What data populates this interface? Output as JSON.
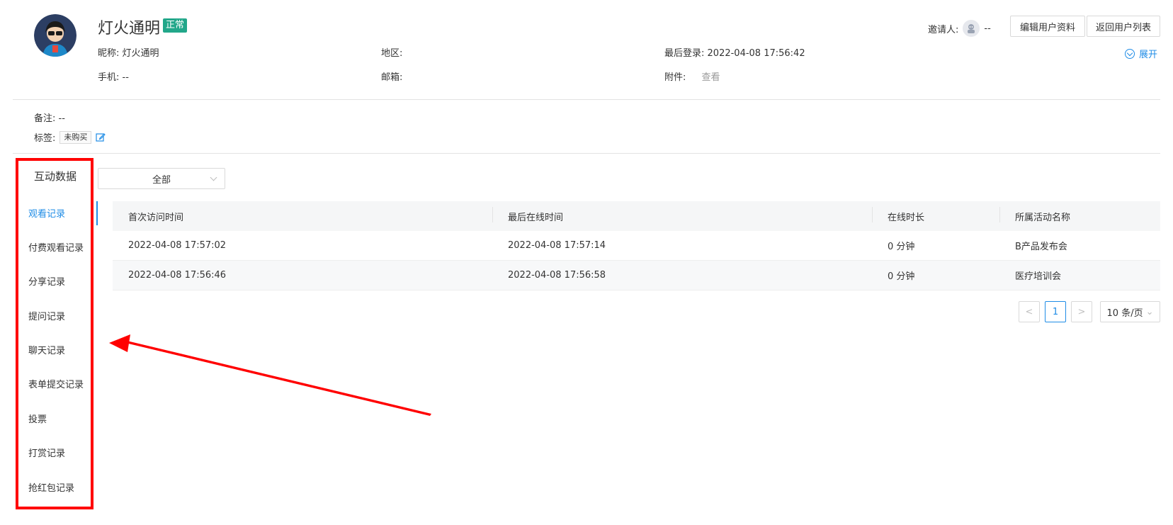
{
  "user": {
    "name": "灯火通明",
    "status": "正常",
    "nickname_label": "昵称:",
    "nickname": "灯火通明",
    "region_label": "地区:",
    "region": "",
    "last_login_label": "最后登录:",
    "last_login": "2022-04-08 17:56:42",
    "phone_label": "手机:",
    "phone": "--",
    "email_label": "邮箱:",
    "email": "",
    "attachment_label": "附件:",
    "attachment_link": "查看",
    "remark_label": "备注:",
    "remark": "--",
    "tags_label": "标签:",
    "tags": [
      "未购买"
    ]
  },
  "header": {
    "inviter_label": "邀请人:",
    "inviter_value": "--",
    "edit_button": "编辑用户资料",
    "back_button": "返回用户列表",
    "expand_label": "展开"
  },
  "sidebar": {
    "title": "互动数据",
    "active_index": 0,
    "items": [
      "观看记录",
      "付费观看记录",
      "分享记录",
      "提问记录",
      "聊天记录",
      "表单提交记录",
      "投票",
      "打赏记录",
      "抢红包记录"
    ]
  },
  "filter": {
    "selected": "全部"
  },
  "table": {
    "columns": [
      "首次访问时间",
      "最后在线时间",
      "在线时长",
      "所属活动名称"
    ],
    "rows": [
      [
        "2022-04-08 17:57:02",
        "2022-04-08 17:57:14",
        "0 分钟",
        "B产品发布会"
      ],
      [
        "2022-04-08 17:56:46",
        "2022-04-08 17:56:58",
        "0 分钟",
        "医疗培训会"
      ]
    ]
  },
  "pagination": {
    "prev": "<",
    "current_page": "1",
    "next": ">",
    "page_size": "10 条/页"
  },
  "colors": {
    "accent": "#1f8ce6",
    "status_badge": "#22a78a",
    "annotation_red": "#ff0000"
  }
}
